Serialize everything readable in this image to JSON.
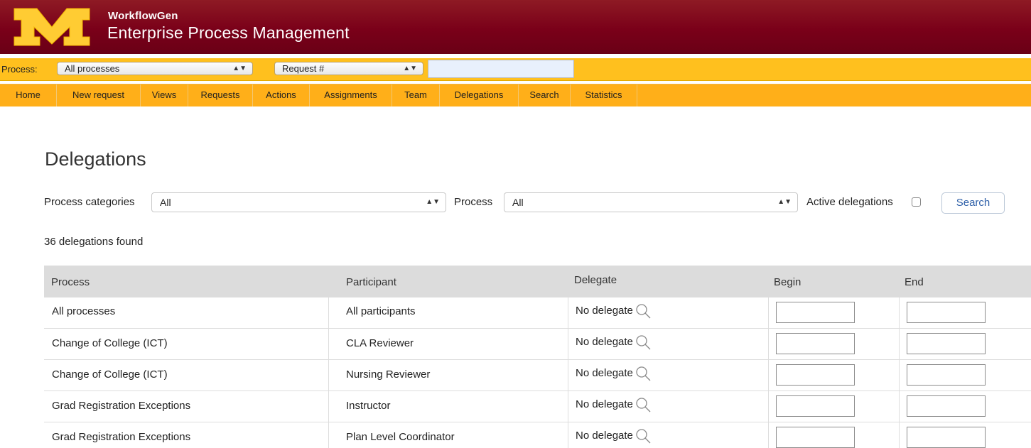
{
  "header": {
    "brand_small": "WorkflowGen",
    "brand_big": "Enterprise Process Management",
    "colors": {
      "maroon": "#7a0019",
      "gold": "#ffc01e"
    }
  },
  "procbar": {
    "label": "Process:",
    "process_select": "All processes",
    "request_select": "Request #",
    "request_input_value": ""
  },
  "nav": {
    "items": [
      "Home",
      "New request",
      "Views",
      "Requests",
      "Actions",
      "Assignments",
      "Team",
      "Delegations",
      "Search",
      "Statistics"
    ]
  },
  "page": {
    "title": "Delegations",
    "filters": {
      "categories_label": "Process categories",
      "categories_value": "All",
      "process_label": "Process",
      "process_value": "All",
      "active_label": "Active delegations",
      "active_checked": false,
      "search_label": "Search"
    },
    "count_text": "36 delegations found"
  },
  "table": {
    "columns": [
      "Process",
      "Participant",
      "Delegate",
      "Begin",
      "End"
    ],
    "rows": [
      {
        "process": "All processes",
        "participant": "All participants",
        "delegate": "No delegate"
      },
      {
        "process": "Change of College (ICT)",
        "participant": "CLA Reviewer",
        "delegate": "No delegate"
      },
      {
        "process": "Change of College (ICT)",
        "participant": "Nursing Reviewer",
        "delegate": "No delegate"
      },
      {
        "process": "Grad Registration Exceptions",
        "participant": "Instructor",
        "delegate": "No delegate"
      },
      {
        "process": "Grad Registration Exceptions",
        "participant": "Plan Level Coordinator",
        "delegate": "No delegate"
      }
    ]
  }
}
